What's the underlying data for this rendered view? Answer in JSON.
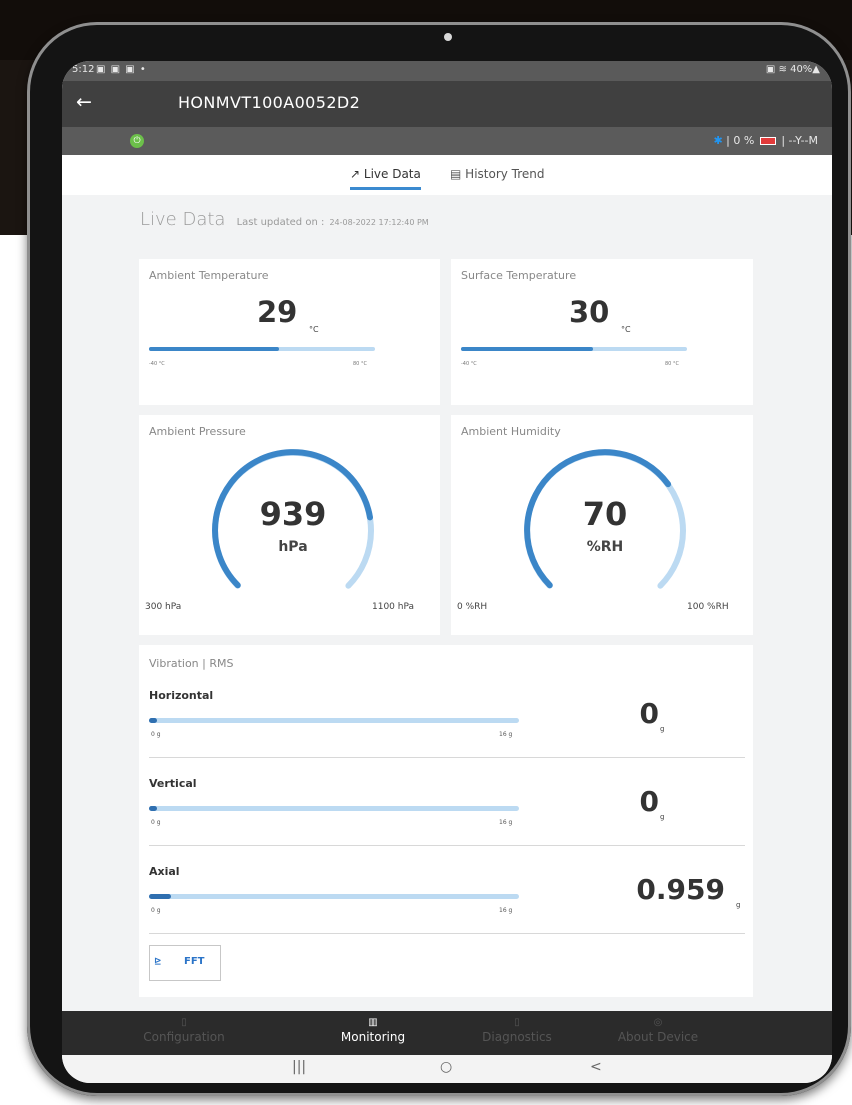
{
  "status_bar": {
    "time": "5:12",
    "icons": "▣ ▣ ▣ •",
    "right": "▣ ≋ 40%▲"
  },
  "app_bar": {
    "back_icon": "←",
    "title": "HONMVT100A0052D2"
  },
  "device_bar": {
    "power_icon": "⏻",
    "bluetooth_icon": "✱",
    "status_prefix": "| 0 %",
    "status_suffix": "| --Y--M"
  },
  "tabs": {
    "live": {
      "icon": "↗",
      "label": "Live Data"
    },
    "history": {
      "icon": "▤",
      "label": "History Trend"
    }
  },
  "live": {
    "title": "Live Data",
    "updated_label": "Last updated on :",
    "updated_value": "24-08-2022 17:12:40 PM"
  },
  "ambient_temp": {
    "label": "Ambient Temperature",
    "value": "29",
    "unit": "°C",
    "min_label": "-40 °C",
    "max_label": "80 °C",
    "fill_fraction": 0.575
  },
  "surface_temp": {
    "label": "Surface Temperature",
    "value": "30",
    "unit": "°C",
    "min_label": "-40 °C",
    "max_label": "80 °C",
    "fill_fraction": 0.583
  },
  "pressure": {
    "label": "Ambient Pressure",
    "value": "939",
    "unit": "hPa",
    "min_label": "300 hPa",
    "max_label": "1100 hPa",
    "fill_fraction": 0.799
  },
  "humidity": {
    "label": "Ambient Humidity",
    "value": "70",
    "unit": "%RH",
    "min_label": "0 %RH",
    "max_label": "100 %RH",
    "fill_fraction": 0.7
  },
  "vibration": {
    "title": "Vibration | RMS",
    "axes": [
      {
        "name": "Horizontal",
        "value": "0",
        "unit": "g",
        "min_label": "0 g",
        "max_label": "16 g",
        "fill_fraction": 0.0
      },
      {
        "name": "Vertical",
        "value": "0",
        "unit": "g",
        "min_label": "0 g",
        "max_label": "16 g",
        "fill_fraction": 0.0
      },
      {
        "name": "Axial",
        "value": "0.959",
        "unit": "g",
        "min_label": "0 g",
        "max_label": "16 g",
        "fill_fraction": 0.06
      }
    ],
    "fft_icon": "⊵",
    "fft_label": "FFT"
  },
  "bottom_nav": [
    {
      "icon": "▯",
      "label": "Configuration"
    },
    {
      "icon": "▥",
      "label": "Monitoring"
    },
    {
      "icon": "▯",
      "label": "Diagnostics"
    },
    {
      "icon": "◎",
      "label": "About Device"
    }
  ],
  "system_nav": {
    "recents": "|||",
    "home": "○",
    "back": "<"
  },
  "colors": {
    "accent": "#3b86c8",
    "track": "#bcdaf2",
    "appbar": "#404040",
    "power": "#6cc04a"
  }
}
